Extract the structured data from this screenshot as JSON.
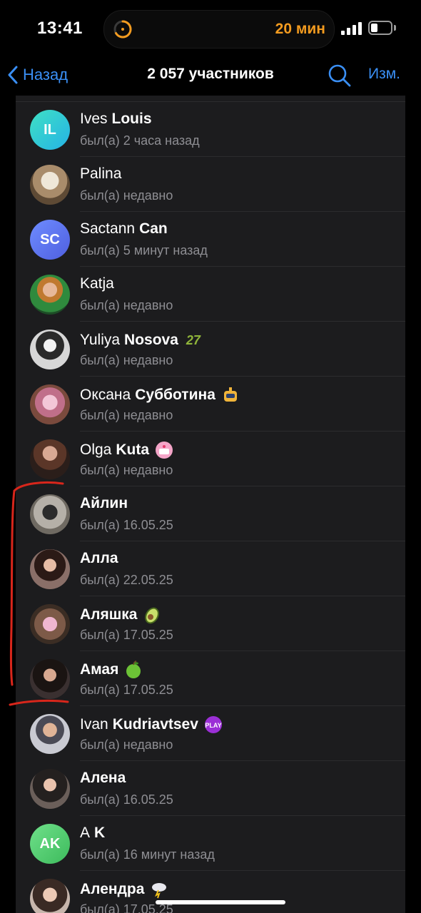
{
  "status_bar": {
    "time": "13:41",
    "timer": "20 мин"
  },
  "nav": {
    "back_label": "Назад",
    "title": "2 057 участников",
    "edit_label": "Изм."
  },
  "members": [
    {
      "first": "Ives",
      "last": "Louis",
      "status": "был(а) 2 часа назад",
      "initials": "IL",
      "avatar_color": "#2ec9d3",
      "emoji": ""
    },
    {
      "first": "Palina",
      "last": "",
      "status": "был(а) недавно",
      "initials": "",
      "emoji": ""
    },
    {
      "first": "Sactann",
      "last": "Can",
      "status": "был(а) 5 минут назад",
      "initials": "SC",
      "avatar_color": "#5b7cf0",
      "emoji": ""
    },
    {
      "first": "Katja",
      "last": "",
      "status": "был(а) недавно",
      "initials": "",
      "emoji": ""
    },
    {
      "first": "Yuliya",
      "last": "Nosova",
      "status": "был(а) недавно",
      "initials": "",
      "emoji": "27"
    },
    {
      "first": "Оксана",
      "last": "Субботина",
      "status": "был(а) недавно",
      "initials": "",
      "emoji": "robot"
    },
    {
      "first": "Olga",
      "last": "Kuta",
      "status": "был(а) недавно",
      "initials": "",
      "emoji": "cake"
    },
    {
      "first": "Айлин",
      "last": "",
      "status": "был(а) 16.05.25",
      "initials": "",
      "emoji": ""
    },
    {
      "first": "Алла",
      "last": "",
      "status": "был(а) 22.05.25",
      "initials": "",
      "emoji": ""
    },
    {
      "first": "Аляшка",
      "last": "",
      "status": "был(а) 17.05.25",
      "initials": "",
      "emoji": "avocado"
    },
    {
      "first": "Амая",
      "last": "",
      "status": "был(а) 17.05.25",
      "initials": "",
      "emoji": "apple"
    },
    {
      "first": "Ivan",
      "last": "Kudriavtsev",
      "status": "был(а) недавно",
      "initials": "",
      "emoji": "play"
    },
    {
      "first": "Алена",
      "last": "",
      "status": "был(а) 16.05.25",
      "initials": "",
      "emoji": ""
    },
    {
      "first": "A",
      "last": "K",
      "status": "был(а) 16 минут назад",
      "initials": "AK",
      "avatar_color": "#4cc96a",
      "emoji": ""
    },
    {
      "first": "Алендра",
      "last": "",
      "status": "был(а) 17.05.25",
      "initials": "",
      "emoji": "cloud"
    }
  ],
  "colors": {
    "accent": "#3a8ff5",
    "timer": "#f39b1f",
    "annotation": "#d8261b"
  }
}
